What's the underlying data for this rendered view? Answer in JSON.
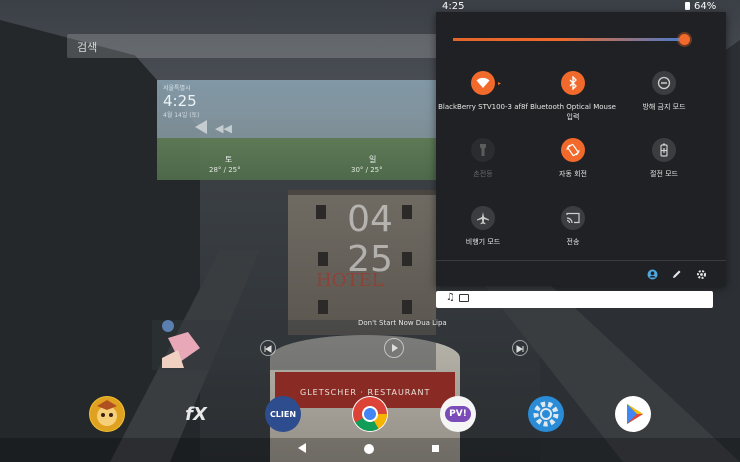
{
  "status_bar": {
    "time": "4:25",
    "battery": "64%"
  },
  "quick_settings": {
    "brightness_level": 0.98,
    "accent_color": "#f26a2b",
    "tiles": [
      {
        "id": "wifi",
        "label": "BlackBerry STV100-3 af8f",
        "sub": "",
        "state": "on",
        "icon": "wifi-icon"
      },
      {
        "id": "bluetooth",
        "label": "Bluetooth Optical Mouse",
        "sub": "입력",
        "state": "on",
        "icon": "bluetooth-icon"
      },
      {
        "id": "dnd",
        "label": "방해 금지 모드",
        "sub": "",
        "state": "off",
        "icon": "do-not-disturb-icon"
      },
      {
        "id": "flashlight",
        "label": "손전등",
        "sub": "",
        "state": "disabled",
        "icon": "flashlight-icon"
      },
      {
        "id": "autorotate",
        "label": "자동 회전",
        "sub": "",
        "state": "on",
        "icon": "auto-rotate-icon"
      },
      {
        "id": "battery_saver",
        "label": "절전 모드",
        "sub": "",
        "state": "off",
        "icon": "battery-saver-icon"
      },
      {
        "id": "airplane",
        "label": "비행기 모드",
        "sub": "",
        "state": "off",
        "icon": "airplane-icon"
      },
      {
        "id": "cast",
        "label": "전송",
        "sub": "",
        "state": "off",
        "icon": "cast-icon"
      }
    ],
    "footer_icons": [
      "user-icon",
      "edit-icon",
      "settings-icon"
    ]
  },
  "media_notification": {
    "icons": [
      "music-note-icon",
      "media-box-icon"
    ]
  },
  "home": {
    "search_label": "검색",
    "weather": {
      "location": "서울특별시",
      "time": "4:25",
      "date": "4월 14일 (토)",
      "days": [
        {
          "name": "토",
          "temps": "28° / 25°"
        },
        {
          "name": "일",
          "temps": "30° / 25°"
        }
      ]
    },
    "clock": {
      "hour": "04",
      "minute": "25"
    },
    "hotel_sign": "HOTEL",
    "tower_sign": "GLETSCHER · RESTAURANT",
    "music_title": "Don't Start Now Dua Lipa",
    "dock": [
      {
        "name": "clash-of-clans-app",
        "glyph": ""
      },
      {
        "name": "fx-file-explorer-app",
        "glyph": "fX"
      },
      {
        "name": "clien-app",
        "glyph": "CLIEN"
      },
      {
        "name": "chrome-app",
        "glyph": ""
      },
      {
        "name": "pv-app",
        "glyph": "PV!"
      },
      {
        "name": "settings-app",
        "glyph": ""
      },
      {
        "name": "play-store-app",
        "glyph": ""
      }
    ]
  }
}
